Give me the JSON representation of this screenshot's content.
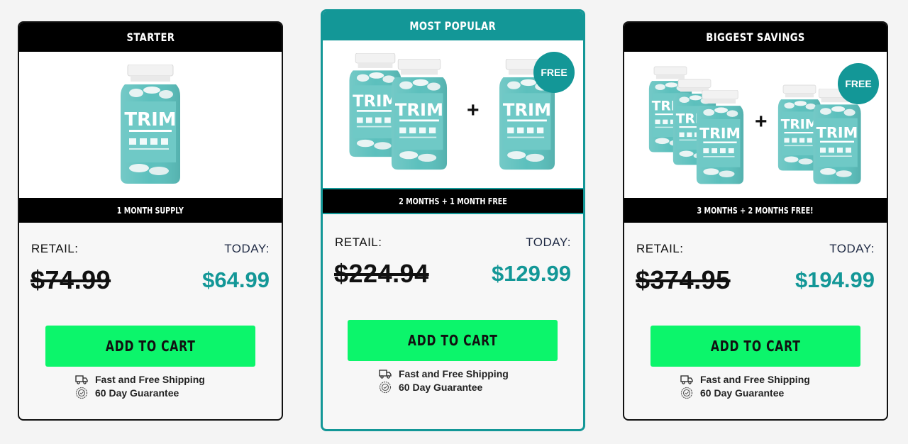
{
  "cards": [
    {
      "header": "STARTER",
      "supply": "1 MONTH SUPPLY",
      "retail_label": "RETAIL:",
      "today_label": "TODAY:",
      "old_price": "$74.99",
      "new_price": "$64.99",
      "cta": "ADD TO CART",
      "perks": [
        "Fast and Free Shipping",
        "60 Day Guarantee"
      ],
      "bottle_label": "TRIM"
    },
    {
      "header": "MOST POPULAR",
      "supply": "2 MONTHS + 1 MONTH FREE",
      "retail_label": "RETAIL:",
      "today_label": "TODAY:",
      "old_price": "$224.94",
      "new_price": "$129.99",
      "cta": "ADD TO CART",
      "perks": [
        "Fast and Free Shipping",
        "60 Day Guarantee"
      ],
      "bottle_label": "TRIM",
      "plus": "+",
      "badge": "FREE"
    },
    {
      "header": "BIGGEST SAVINGS",
      "supply": "3 MONTHS + 2 MONTHS FREE!",
      "retail_label": "RETAIL:",
      "today_label": "TODAY:",
      "old_price": "$374.95",
      "new_price": "$194.99",
      "cta": "ADD TO CART",
      "perks": [
        "Fast and Free Shipping",
        "60 Day Guarantee"
      ],
      "bottle_label": "TRIM",
      "plus": "+",
      "badge": "FREE"
    }
  ],
  "colors": {
    "accent": "#139797",
    "cta": "#0cf56b",
    "header_bg": "#000000"
  },
  "icons": [
    "shipping-truck-icon",
    "guarantee-badge-icon",
    "supplement-bottle-icon"
  ]
}
